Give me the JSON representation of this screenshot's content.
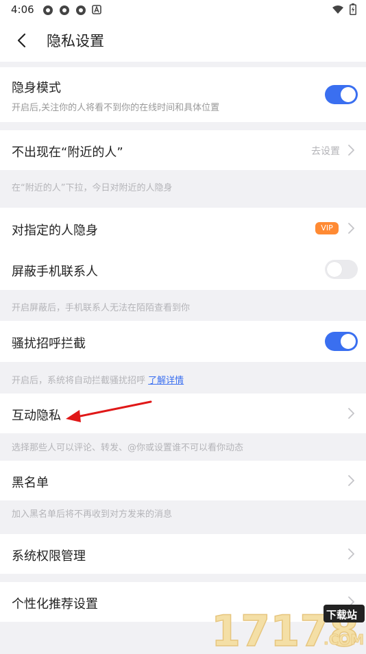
{
  "status_bar": {
    "time": "4:06"
  },
  "header": {
    "title": "隐私设置"
  },
  "rows": {
    "stealth": {
      "title": "隐身模式",
      "subtitle": "开启后,关注你的人将看不到你的在线时间和具体位置",
      "toggle": "on"
    },
    "nearby": {
      "title": "不出现在“附近的人”",
      "action": "去设置",
      "hint": "在“附近的人”下拉，今日对附近的人隐身"
    },
    "specific": {
      "title": "对指定的人隐身",
      "badge": "VIP"
    },
    "contacts": {
      "title": "屏蔽手机联系人",
      "toggle": "off",
      "hint": "开启屏蔽后，手机联系人无法在陌陌查看到你"
    },
    "harass": {
      "title": "骚扰招呼拦截",
      "toggle": "on",
      "hint": "开启后，系统将自动拦截骚扰招呼",
      "hint_link": "了解详情"
    },
    "interact": {
      "title": "互动隐私",
      "hint": "选择那些人可以评论、转发、@你或设置谁不可以看你动态"
    },
    "blacklist": {
      "title": "黑名单",
      "hint": "加入黑名单后将不再收到对方发来的消息"
    },
    "permissions": {
      "title": "系统权限管理"
    },
    "personalize": {
      "title": "个性化推荐设置"
    }
  },
  "watermark": {
    "digits": "17178",
    "site": "下载站",
    "domain": ".COM"
  },
  "colors": {
    "accent": "#3a6ff0",
    "vip": "#ff8a33",
    "background": "#f1f1f4",
    "annotation": "#e01818"
  }
}
